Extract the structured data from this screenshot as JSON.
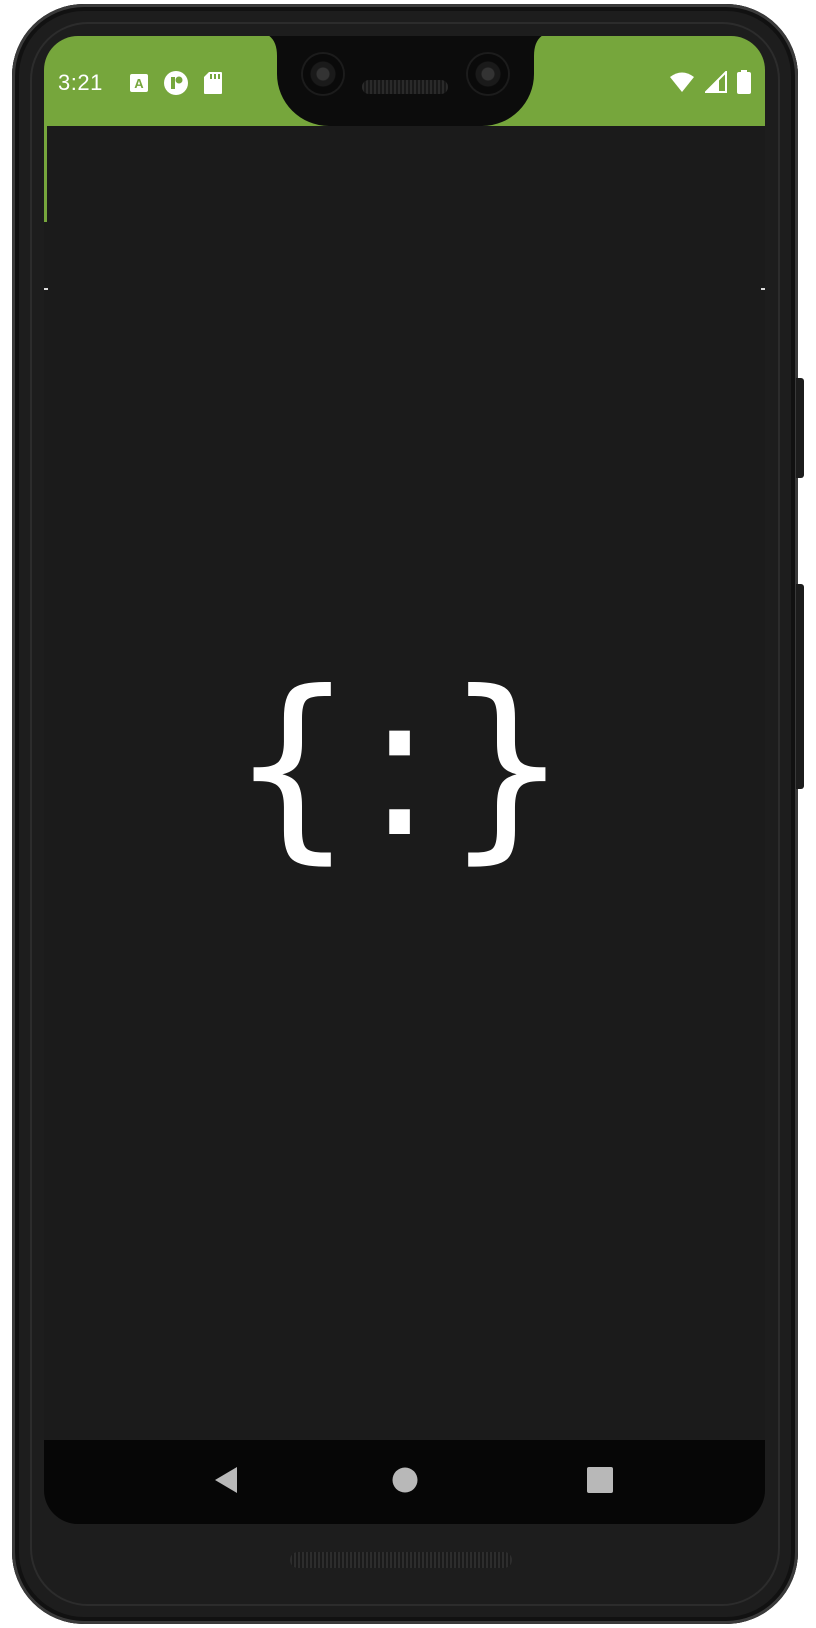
{
  "status_bar": {
    "time": "3:21",
    "left_icons": [
      "accessibility-a-icon",
      "vpn-key-icon",
      "sd-card-icon"
    ],
    "right_icons": [
      "wifi-icon",
      "cellular-signal-icon",
      "battery-icon"
    ],
    "background_color": "#76a63c"
  },
  "app": {
    "logo_text": "{:}",
    "background_color": "#1b1b1b"
  },
  "nav_bar": {
    "buttons": [
      "back-icon",
      "home-icon",
      "recents-icon"
    ]
  }
}
